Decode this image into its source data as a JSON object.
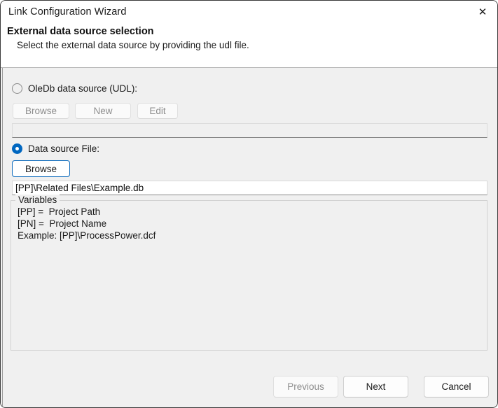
{
  "window": {
    "title": "Link Configuration Wizard",
    "close_icon": "close-icon",
    "close_glyph": "✕"
  },
  "header": {
    "title": "External data source selection",
    "subtitle": "Select the external data source by providing the udl file."
  },
  "oledb_section": {
    "radio_label": "OleDb data source (UDL):",
    "selected": false,
    "buttons": [
      {
        "label": "Browse",
        "enabled": false
      },
      {
        "label": "New",
        "enabled": false
      },
      {
        "label": "Edit",
        "enabled": false
      }
    ],
    "path_value": "",
    "path_enabled": false
  },
  "file_section": {
    "radio_label": "Data source File:",
    "selected": true,
    "browse_label": "Browse",
    "path_value": "[PP]\\Related Files\\Example.db"
  },
  "variables_group": {
    "legend": "Variables",
    "lines": [
      "[PP] =  Project Path",
      "[PN] =  Project Name",
      "Example: [PP]\\ProcessPower.dcf"
    ]
  },
  "footer": {
    "previous_label": "Previous",
    "next_label": "Next",
    "cancel_label": "Cancel",
    "previous_enabled": false
  },
  "colors": {
    "accent": "#0067c0",
    "focus_border": "#0f6cbd",
    "body_bg": "#f0f0f0",
    "header_bg": "#ffffff",
    "disabled_text": "#8d8d8d"
  }
}
